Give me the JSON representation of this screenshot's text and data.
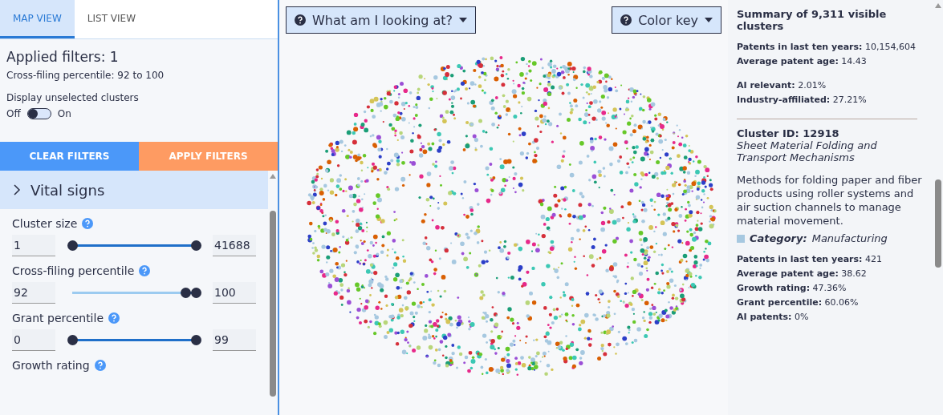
{
  "tabs": [
    {
      "label": "MAP VIEW",
      "selected": true
    },
    {
      "label": "LIST VIEW",
      "selected": false
    }
  ],
  "filters": {
    "title": "Applied filters: 1",
    "summary": "Cross-filing percentile: 92 to 100",
    "toggle_label": "Display unselected clusters",
    "off_label": "Off",
    "on_label": "On",
    "on": false
  },
  "buttons": [
    {
      "label": "CLEAR FILTERS",
      "kind": "clear"
    },
    {
      "label": "APPLY FILTERS",
      "kind": "apply"
    }
  ],
  "section": {
    "label": "Vital signs",
    "expanded": false
  },
  "sliders": [
    {
      "label": "Cluster size",
      "min": "1",
      "max": "41688",
      "thumbs": [
        {
          "level": 0
        },
        {
          "level": 1
        }
      ]
    },
    {
      "label": "Cross-filing percentile",
      "min": "92",
      "max": "100",
      "thumbs": [
        {
          "level": 0.92
        },
        {
          "level": 1
        }
      ]
    },
    {
      "label": "Grant percentile",
      "min": "0",
      "max": "99",
      "thumbs": [
        {
          "level": 0
        },
        {
          "level": 1
        }
      ]
    }
  ],
  "next_slider_label": "Growth rating",
  "map_buttons": [
    {
      "label": "What am I looking at?"
    },
    {
      "label": "Color key"
    }
  ],
  "summary": {
    "title": "Summary of 9,311 visible clusters",
    "groups": [
      [
        "**Patents in last ten years:** 10,154,604",
        "**Average patent age:** 14.43"
      ],
      [
        "**AI relevant:** 2.01%",
        "**Industry-affiliated:** 27.21%"
      ]
    ]
  },
  "cluster": {
    "id": "Cluster ID: 12918",
    "name": "Sheet Material Folding and Transport Mechanisms",
    "description": "Methods for folding paper and fiber products using roller systems and air suction channels to manage material movement.",
    "category_label": "Category:",
    "category": "Manufacturing",
    "stats": [
      "**Patents in last ten years:** 421",
      "**Average patent age:** 38.62",
      "**Growth rating:** 47.36%",
      "**Grant percentile:** 60.06%",
      "**AI patents:** 0%"
    ]
  }
}
